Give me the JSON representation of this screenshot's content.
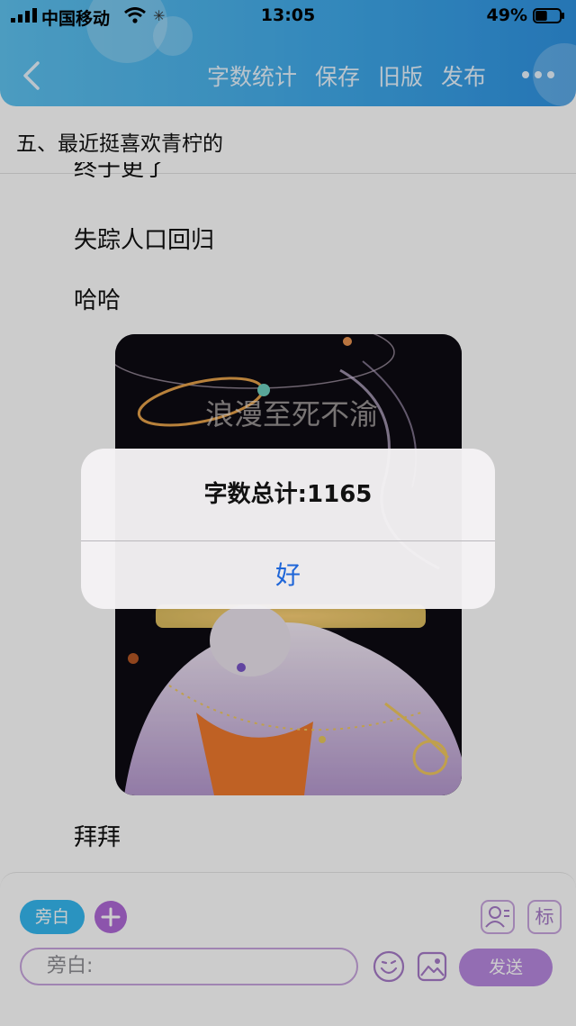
{
  "status_bar": {
    "carrier": "中国移动",
    "time": "13:05",
    "battery_percent": "49%",
    "battery_level": 0.49
  },
  "nav": {
    "actions": [
      "字数统计",
      "保存",
      "旧版",
      "发布"
    ]
  },
  "chapter": {
    "title": "五、最近挺喜欢青柠的"
  },
  "content": {
    "lines": [
      "终于更了",
      "失踪人口回归",
      "哈哈"
    ],
    "image_lettering": "浪漫至死不渝",
    "closing": "拜拜"
  },
  "composer": {
    "role_chip": "旁白",
    "label_tool": "标",
    "input_placeholder": "旁白:",
    "send_label": "发送"
  },
  "alert": {
    "message": "字数总计:1165",
    "ok_label": "好"
  },
  "colors": {
    "header_gradient": [
      "#5fc3f0",
      "#2f93e2"
    ],
    "accent_purple": "#b889e0",
    "accent_blue": "#35b8f0",
    "alert_button": "#1f66d8"
  }
}
